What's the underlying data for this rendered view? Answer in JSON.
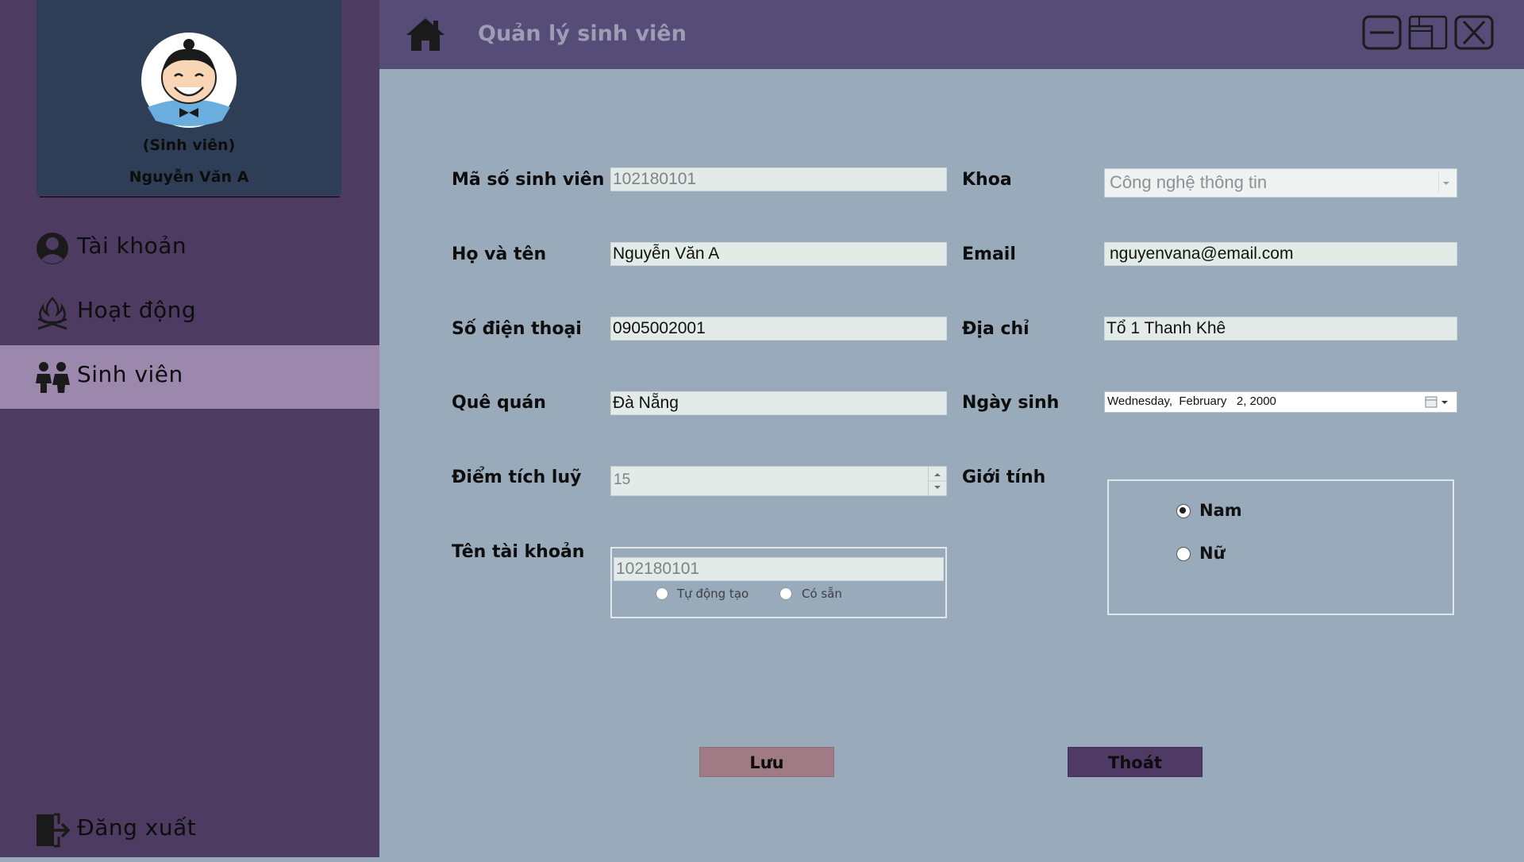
{
  "sidebar": {
    "profile": {
      "role": "(Sinh viên)",
      "name": "Nguyễn Văn A"
    },
    "items": [
      {
        "label": "Tài khoản",
        "icon": "user-circle-icon",
        "active": false
      },
      {
        "label": "Hoạt động",
        "icon": "campfire-icon",
        "active": false
      },
      {
        "label": "Sinh viên",
        "icon": "students-icon",
        "active": true
      }
    ],
    "logout": {
      "label": "Đăng xuất",
      "icon": "logout-door-icon"
    }
  },
  "header": {
    "title": "Quản lý sinh viên",
    "home_icon": "home-icon",
    "window_controls": [
      "minimize-icon",
      "restore-icon",
      "close-icon"
    ]
  },
  "form": {
    "student_id": {
      "label": "Mã số sinh viên",
      "value": "102180101"
    },
    "full_name": {
      "label": "Họ và tên",
      "value": "Nguyễn Văn A"
    },
    "phone": {
      "label": "Số điện thoại",
      "value": "0905002001"
    },
    "hometown": {
      "label": "Quê quán",
      "value": "Đà Nẵng"
    },
    "points": {
      "label": "Điểm tích luỹ",
      "value": "15"
    },
    "account": {
      "label": "Tên tài khoản",
      "value": "102180101",
      "options": [
        "Tự động tạo",
        "Có sẵn"
      ]
    },
    "faculty": {
      "label": "Khoa",
      "value": "Công nghệ thông tin"
    },
    "email": {
      "label": "Email",
      "value": "nguyenvana@email.com"
    },
    "address": {
      "label": "Địa chỉ",
      "value": "Tổ 1 Thanh Khê"
    },
    "birthday": {
      "label": "Ngày sinh",
      "value": "Wednesday,  February   2, 2000"
    },
    "gender": {
      "label": "Giới tính",
      "options": [
        "Nam",
        "Nữ"
      ],
      "selected": "Nam"
    }
  },
  "buttons": {
    "save": "Lưu",
    "exit": "Thoát"
  },
  "colors": {
    "sidebar_bg": "#4e3b62",
    "profile_bg": "#2e3e56",
    "active_item_bg": "#9c87ad",
    "header_bg": "#554c77",
    "content_bg": "#99abbb",
    "save_button": "#a07a84",
    "exit_button": "#4f3a66"
  }
}
